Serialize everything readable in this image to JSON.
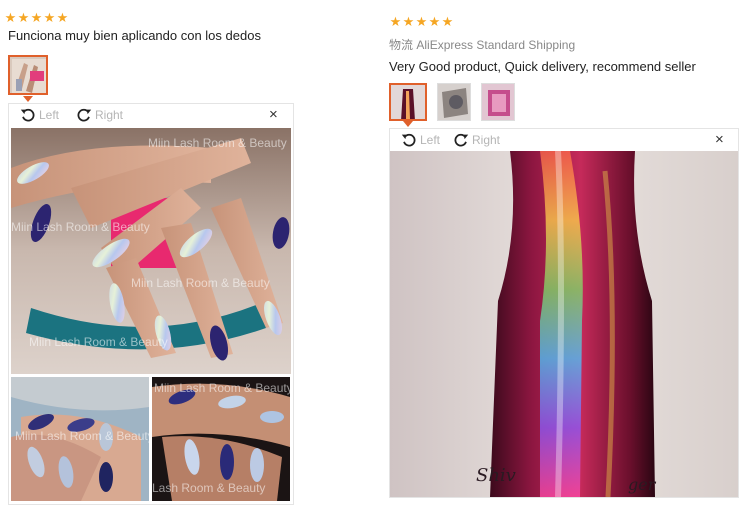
{
  "icons": {
    "star": "★",
    "close": "×",
    "rotate_left": "rotate-left-icon",
    "rotate_right": "rotate-right-icon"
  },
  "colors": {
    "star": "#f5a623",
    "accent": "#e0602b",
    "muted": "#888888"
  },
  "review_left": {
    "rating": 5,
    "text": "Funciona muy bien aplicando con los dedos",
    "viewer": {
      "rotate_left_label": "Left",
      "rotate_right_label": "Right",
      "watermarks": [
        "Miin Lash Room & Beauty",
        "Miin Lash Room & Beauty",
        "Miin Lash Room & Beauty",
        "Miin Lash Room & Beauty",
        "Miin Lash Room & Beauty",
        "Miin Lash Room & Beauty",
        "Lash Room & Beauty"
      ]
    }
  },
  "review_right": {
    "rating": 5,
    "shipping_cn": "物流",
    "shipping": "AliExpress Standard Shipping",
    "text": "Very Good product, Quick delivery, recommend seller",
    "viewer": {
      "rotate_left_label": "Left",
      "rotate_right_label": "Right",
      "signature_left": "Shiv",
      "signature_right": "ger"
    }
  }
}
